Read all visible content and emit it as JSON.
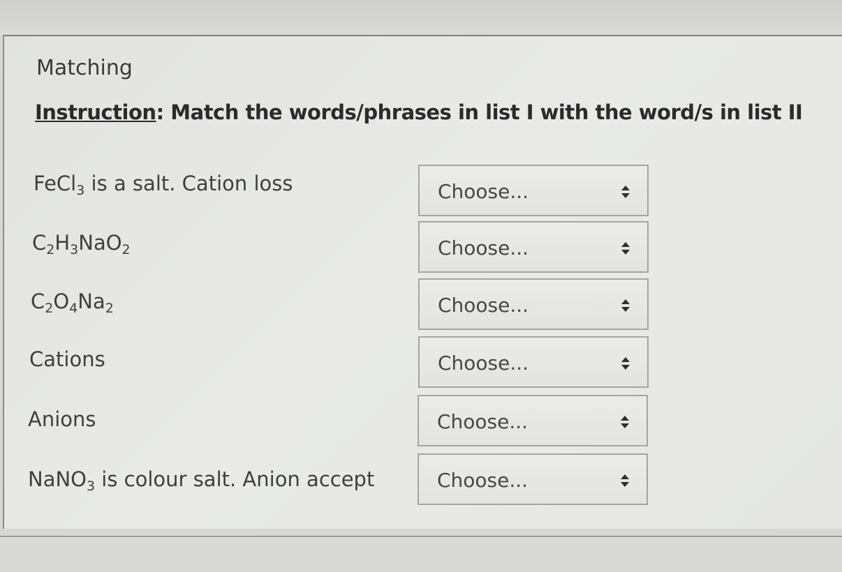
{
  "quiz": {
    "heading": "Matching",
    "instruction_lead": "Instruction",
    "instruction_rest": ": Match the words/phrases in list I with the word/s in list II",
    "rows": [
      {
        "term_parts": [
          "FeCl",
          "3",
          " is a salt. Cation loss"
        ],
        "select_value": "Choose..."
      },
      {
        "term_parts": [
          "C",
          "2",
          "H",
          "3",
          "NaO",
          "2"
        ],
        "select_value": "Choose..."
      },
      {
        "term_parts": [
          "C",
          "2",
          "O",
          "4",
          "Na",
          "2"
        ],
        "select_value": "Choose..."
      },
      {
        "term_parts": [
          "Cations"
        ],
        "select_value": "Choose..."
      },
      {
        "term_parts": [
          "Anions"
        ],
        "select_value": "Choose..."
      },
      {
        "term_parts": [
          "NaNO",
          "3",
          " is colour salt. Anion accept"
        ],
        "select_value": "Choose..."
      }
    ],
    "select_icon": "up-down-arrows-icon"
  }
}
